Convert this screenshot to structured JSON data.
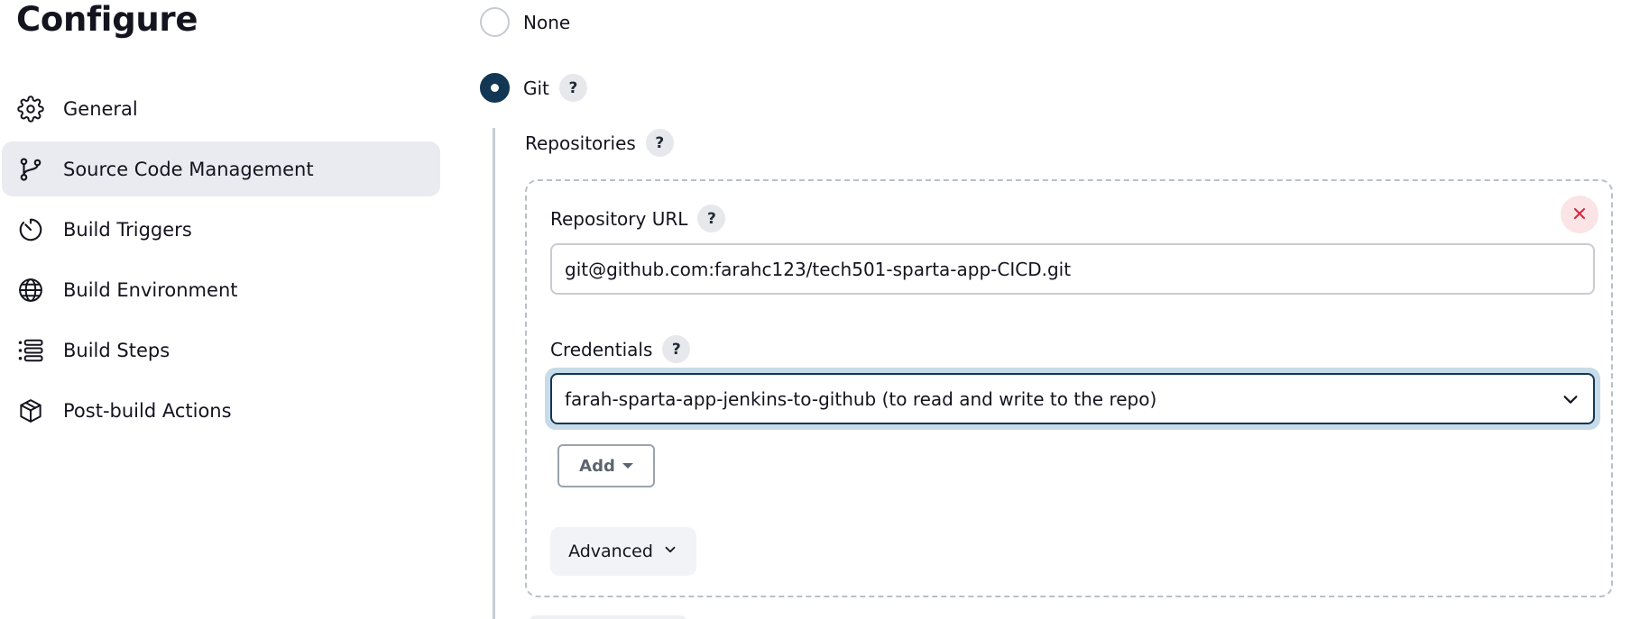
{
  "page_title": "Configure",
  "sidebar": {
    "items": [
      {
        "label": "General",
        "icon": "gear-icon",
        "active": false
      },
      {
        "label": "Source Code Management",
        "icon": "git-branch-icon",
        "active": true
      },
      {
        "label": "Build Triggers",
        "icon": "timer-icon",
        "active": false
      },
      {
        "label": "Build Environment",
        "icon": "globe-icon",
        "active": false
      },
      {
        "label": "Build Steps",
        "icon": "list-icon",
        "active": false
      },
      {
        "label": "Post-build Actions",
        "icon": "package-icon",
        "active": false
      }
    ]
  },
  "scm": {
    "options": [
      {
        "label": "None",
        "checked": false
      },
      {
        "label": "Git",
        "checked": true,
        "help": "?"
      }
    ],
    "repositories_label": "Repositories",
    "repositories_help": "?",
    "repository": {
      "url_label": "Repository URL",
      "url_help": "?",
      "url_value": "git@github.com:farahc123/tech501-sparta-app-CICD.git",
      "credentials_label": "Credentials",
      "credentials_help": "?",
      "credentials_value": "farah-sparta-app-jenkins-to-github (to read and write to the repo)",
      "add_label": "Add",
      "advanced_label": "Advanced",
      "remove_icon": "close-icon"
    }
  },
  "colors": {
    "accent": "#123754",
    "focus_ring": "#c7dbe9",
    "active_nav_bg": "#eaebf0",
    "remove_red": "#d9253a"
  }
}
